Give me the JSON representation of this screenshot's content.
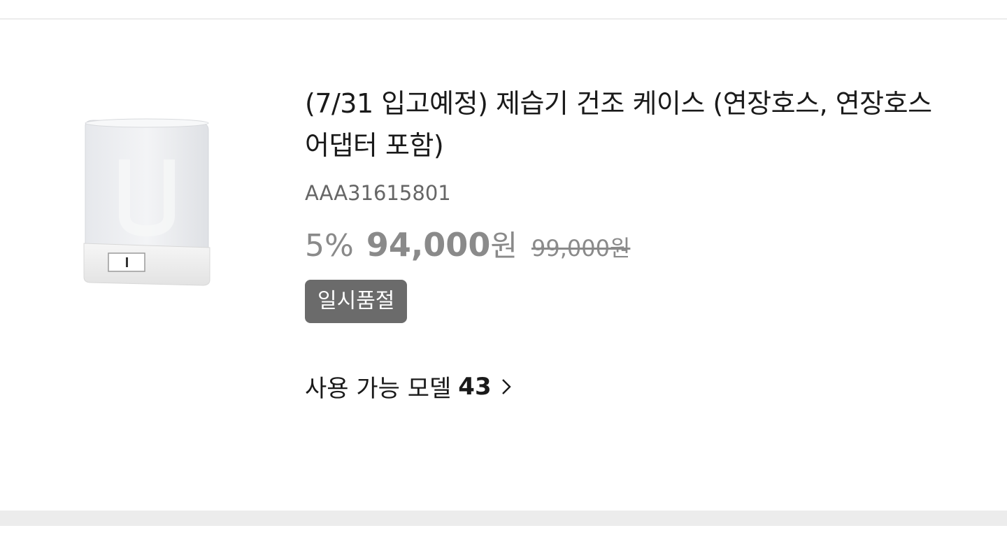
{
  "product": {
    "title": "(7/31 입고예정) 제습기 건조 케이스 (연장호스, 연장호스 어댑터 포함)",
    "sku": "AAA31615801",
    "discount": "5%",
    "price": "94,000",
    "currency": "원",
    "original_price": "99,000원",
    "status_badge": "일시품절",
    "image_icon": "dehumidifier-drying-case-image"
  },
  "models": {
    "label": "사용 가능 모델",
    "count": "43",
    "icon": "chevron-right-icon"
  },
  "colors": {
    "text": "#1a1a1a",
    "muted": "#8a8a8a",
    "badge_bg": "#6b6b6b",
    "divider": "#ececec"
  }
}
